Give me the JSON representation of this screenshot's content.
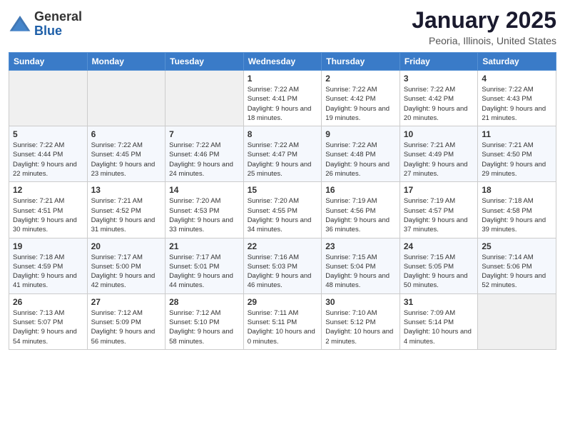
{
  "header": {
    "logo_general": "General",
    "logo_blue": "Blue",
    "month_title": "January 2025",
    "location": "Peoria, Illinois, United States"
  },
  "weekdays": [
    "Sunday",
    "Monday",
    "Tuesday",
    "Wednesday",
    "Thursday",
    "Friday",
    "Saturday"
  ],
  "weeks": [
    [
      {
        "empty": true
      },
      {
        "empty": true
      },
      {
        "empty": true
      },
      {
        "day": "1",
        "sunrise": "7:22 AM",
        "sunset": "4:41 PM",
        "daylight": "9 hours and 18 minutes."
      },
      {
        "day": "2",
        "sunrise": "7:22 AM",
        "sunset": "4:42 PM",
        "daylight": "9 hours and 19 minutes."
      },
      {
        "day": "3",
        "sunrise": "7:22 AM",
        "sunset": "4:42 PM",
        "daylight": "9 hours and 20 minutes."
      },
      {
        "day": "4",
        "sunrise": "7:22 AM",
        "sunset": "4:43 PM",
        "daylight": "9 hours and 21 minutes."
      }
    ],
    [
      {
        "day": "5",
        "sunrise": "7:22 AM",
        "sunset": "4:44 PM",
        "daylight": "9 hours and 22 minutes."
      },
      {
        "day": "6",
        "sunrise": "7:22 AM",
        "sunset": "4:45 PM",
        "daylight": "9 hours and 23 minutes."
      },
      {
        "day": "7",
        "sunrise": "7:22 AM",
        "sunset": "4:46 PM",
        "daylight": "9 hours and 24 minutes."
      },
      {
        "day": "8",
        "sunrise": "7:22 AM",
        "sunset": "4:47 PM",
        "daylight": "9 hours and 25 minutes."
      },
      {
        "day": "9",
        "sunrise": "7:22 AM",
        "sunset": "4:48 PM",
        "daylight": "9 hours and 26 minutes."
      },
      {
        "day": "10",
        "sunrise": "7:21 AM",
        "sunset": "4:49 PM",
        "daylight": "9 hours and 27 minutes."
      },
      {
        "day": "11",
        "sunrise": "7:21 AM",
        "sunset": "4:50 PM",
        "daylight": "9 hours and 29 minutes."
      }
    ],
    [
      {
        "day": "12",
        "sunrise": "7:21 AM",
        "sunset": "4:51 PM",
        "daylight": "9 hours and 30 minutes."
      },
      {
        "day": "13",
        "sunrise": "7:21 AM",
        "sunset": "4:52 PM",
        "daylight": "9 hours and 31 minutes."
      },
      {
        "day": "14",
        "sunrise": "7:20 AM",
        "sunset": "4:53 PM",
        "daylight": "9 hours and 33 minutes."
      },
      {
        "day": "15",
        "sunrise": "7:20 AM",
        "sunset": "4:55 PM",
        "daylight": "9 hours and 34 minutes."
      },
      {
        "day": "16",
        "sunrise": "7:19 AM",
        "sunset": "4:56 PM",
        "daylight": "9 hours and 36 minutes."
      },
      {
        "day": "17",
        "sunrise": "7:19 AM",
        "sunset": "4:57 PM",
        "daylight": "9 hours and 37 minutes."
      },
      {
        "day": "18",
        "sunrise": "7:18 AM",
        "sunset": "4:58 PM",
        "daylight": "9 hours and 39 minutes."
      }
    ],
    [
      {
        "day": "19",
        "sunrise": "7:18 AM",
        "sunset": "4:59 PM",
        "daylight": "9 hours and 41 minutes."
      },
      {
        "day": "20",
        "sunrise": "7:17 AM",
        "sunset": "5:00 PM",
        "daylight": "9 hours and 42 minutes."
      },
      {
        "day": "21",
        "sunrise": "7:17 AM",
        "sunset": "5:01 PM",
        "daylight": "9 hours and 44 minutes."
      },
      {
        "day": "22",
        "sunrise": "7:16 AM",
        "sunset": "5:03 PM",
        "daylight": "9 hours and 46 minutes."
      },
      {
        "day": "23",
        "sunrise": "7:15 AM",
        "sunset": "5:04 PM",
        "daylight": "9 hours and 48 minutes."
      },
      {
        "day": "24",
        "sunrise": "7:15 AM",
        "sunset": "5:05 PM",
        "daylight": "9 hours and 50 minutes."
      },
      {
        "day": "25",
        "sunrise": "7:14 AM",
        "sunset": "5:06 PM",
        "daylight": "9 hours and 52 minutes."
      }
    ],
    [
      {
        "day": "26",
        "sunrise": "7:13 AM",
        "sunset": "5:07 PM",
        "daylight": "9 hours and 54 minutes."
      },
      {
        "day": "27",
        "sunrise": "7:12 AM",
        "sunset": "5:09 PM",
        "daylight": "9 hours and 56 minutes."
      },
      {
        "day": "28",
        "sunrise": "7:12 AM",
        "sunset": "5:10 PM",
        "daylight": "9 hours and 58 minutes."
      },
      {
        "day": "29",
        "sunrise": "7:11 AM",
        "sunset": "5:11 PM",
        "daylight": "10 hours and 0 minutes."
      },
      {
        "day": "30",
        "sunrise": "7:10 AM",
        "sunset": "5:12 PM",
        "daylight": "10 hours and 2 minutes."
      },
      {
        "day": "31",
        "sunrise": "7:09 AM",
        "sunset": "5:14 PM",
        "daylight": "10 hours and 4 minutes."
      },
      {
        "empty": true
      }
    ]
  ],
  "labels": {
    "sunrise": "Sunrise:",
    "sunset": "Sunset:",
    "daylight": "Daylight:"
  }
}
